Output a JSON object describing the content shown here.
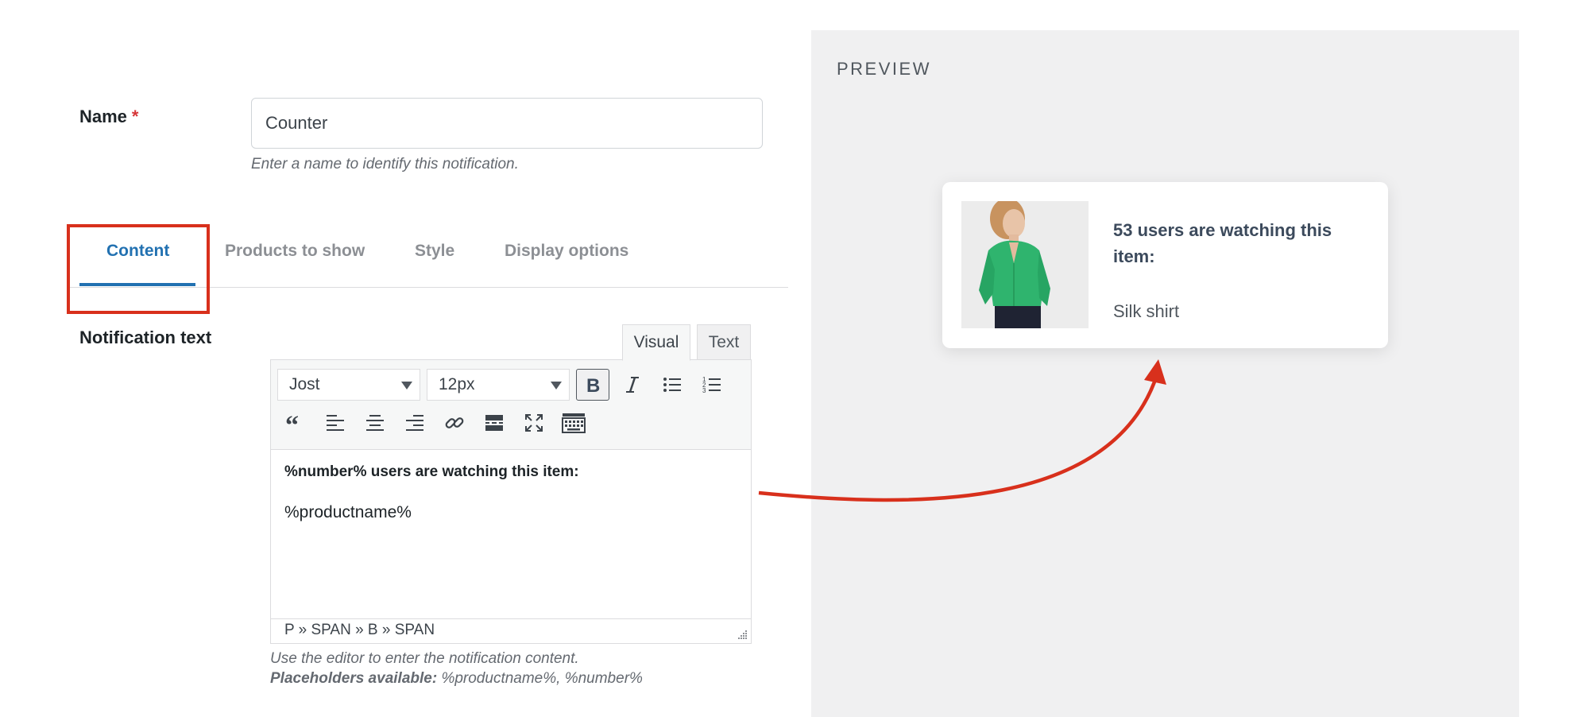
{
  "form": {
    "name_label": "Name",
    "required_mark": "*",
    "name_value": "Counter",
    "name_help": "Enter a name to identify this notification."
  },
  "tabs": [
    {
      "label": "Content",
      "active": true
    },
    {
      "label": "Products to show",
      "active": false
    },
    {
      "label": "Style",
      "active": false
    },
    {
      "label": "Display options",
      "active": false
    }
  ],
  "notification": {
    "label": "Notification text",
    "mode_tabs": {
      "visual": "Visual",
      "text": "Text"
    },
    "font_family": "Jost",
    "font_size": "12px",
    "toolbar_icons": [
      "bold-icon",
      "italic-icon",
      "bullet-list-icon",
      "numbered-list-icon",
      "blockquote-icon",
      "align-left-icon",
      "align-center-icon",
      "align-right-icon",
      "link-icon",
      "read-more-icon",
      "fullscreen-icon",
      "keyboard-icon"
    ],
    "content_line1": "%number% users are watching this item:",
    "content_line2": "%productname%",
    "path": "P » SPAN » B » SPAN",
    "help_text": "Use the editor to enter the notification content.",
    "placeholders_label": "Placeholders available:",
    "placeholders": "%productname%, %number%"
  },
  "preview": {
    "title": "PREVIEW",
    "card_title": "53 users are watching this item:",
    "card_product": "Silk shirt",
    "product_image": "green-silk-shirt-photo"
  },
  "colors": {
    "accent": "#2271b1",
    "highlight": "#d8301c",
    "required": "#d63638",
    "preview_bg": "#f0f0f1",
    "shirt_green": "#2fb46e"
  }
}
